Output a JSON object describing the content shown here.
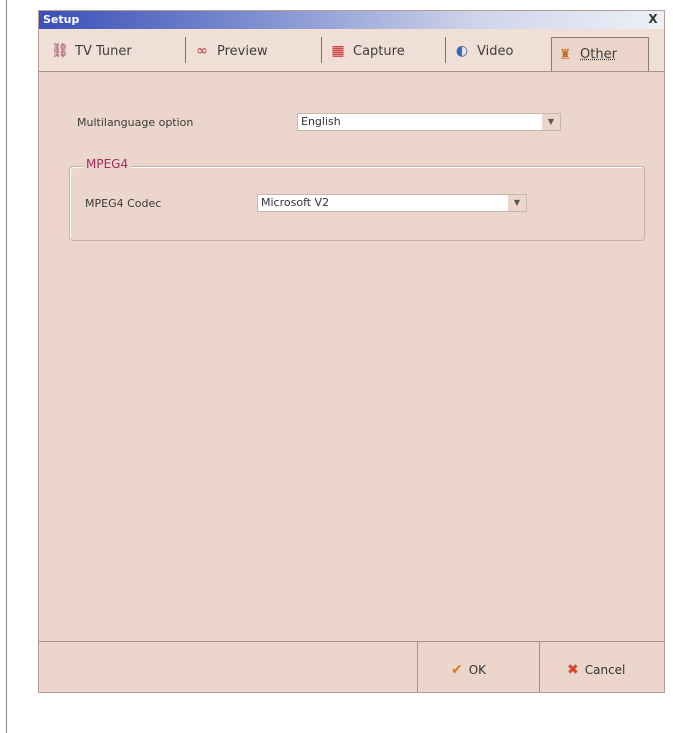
{
  "window": {
    "title": "Setup",
    "close_glyph": "X"
  },
  "tabs": [
    {
      "label": "TV Tuner",
      "icon": "tv-tuner-icon",
      "glyph": "⛓",
      "color": "#8a2a4e"
    },
    {
      "label": "Preview",
      "icon": "preview-icon",
      "glyph": "∞",
      "color": "#b23a3a"
    },
    {
      "label": "Capture",
      "icon": "capture-icon",
      "glyph": "▦",
      "color": "#c62b2b"
    },
    {
      "label": "Video",
      "icon": "video-icon",
      "glyph": "◐",
      "color": "#2f6ab8"
    },
    {
      "label": "Other",
      "icon": "other-icon",
      "glyph": "♜",
      "color": "#c3702a"
    }
  ],
  "active_tab": "Other",
  "multilanguage": {
    "label": "Multilanguage option",
    "value": "English"
  },
  "mpeg4": {
    "group_title": "MPEG4",
    "codec_label": "MPEG4 Codec",
    "codec_value": "Microsoft V2"
  },
  "buttons": {
    "ok": "OK",
    "cancel": "Cancel"
  },
  "colors": {
    "accent": "#a8285a",
    "ok_check": "#d67a1e",
    "cancel_x": "#d8452b"
  }
}
